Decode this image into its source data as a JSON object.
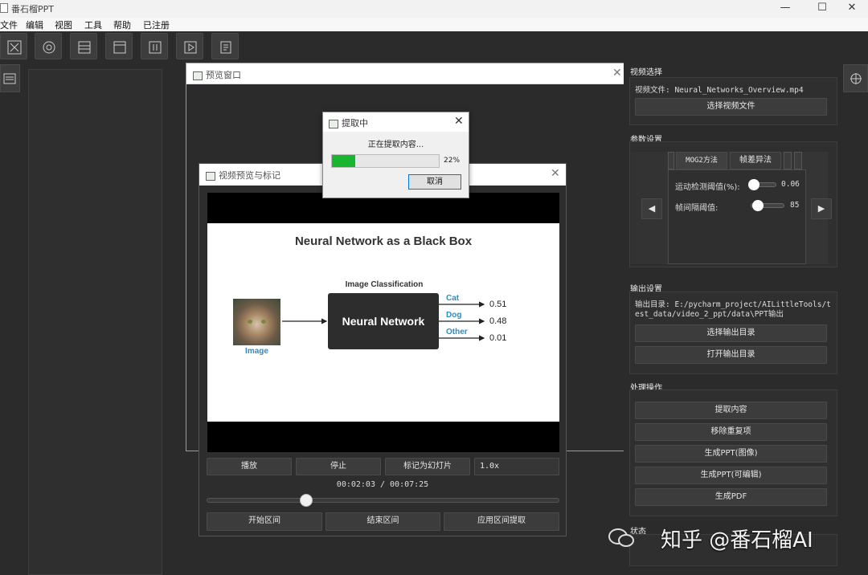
{
  "app": {
    "title": "番石榴PPT"
  },
  "menu": [
    "文件",
    "编辑",
    "视图",
    "工具",
    "帮助",
    "已注册"
  ],
  "toolbar": [
    "close-box-icon",
    "record-icon",
    "layout-icon",
    "window-icon",
    "columns-icon",
    "play-frame-icon",
    "document-icon"
  ],
  "preview_window": {
    "title": "预览窗口"
  },
  "progress_dialog": {
    "title": "提取中",
    "message": "正在提取内容...",
    "percent": "22%",
    "progress": 0.22,
    "cancel": "取消",
    "color": "#19b530"
  },
  "video_window": {
    "title": "视频预览与标记"
  },
  "slide": {
    "title": "Neural Network as a Black Box",
    "subtitle": "Image Classification",
    "box": "Neural Network",
    "image_label": "Image",
    "outputs": [
      {
        "label": "Cat",
        "value": "0.51"
      },
      {
        "label": "Dog",
        "value": "0.48"
      },
      {
        "label": "Other",
        "value": "0.01"
      }
    ],
    "accent": "#2b8cbe"
  },
  "player": {
    "play": "播放",
    "stop": "停止",
    "mark": "标记为幻灯片",
    "speed": "1.0x",
    "time": "00:02:03 / 00:07:25",
    "position": 0.28,
    "start": "开始区间",
    "end": "结束区间",
    "apply": "应用区间提取"
  },
  "right": {
    "video_group": "视频选择",
    "video_file": "视频文件: Neural_Networks_Overview.mp4",
    "choose_video": "选择视频文件",
    "param_group": "参数设置",
    "tab_mog": "MOG2方法",
    "tab_diff": "帧差异法",
    "motion_label": "运动检测阈值(%):",
    "motion_value": "0.06",
    "motion_level": 0.1,
    "frame_label": "帧间隔阈值:",
    "frame_value": "85",
    "frame_level": 0.2,
    "output_group": "输出设置",
    "output_dir": "输出目录: E:/pycharm_project/AILittleTools/test_data/video_2_ppt/data\\PPT输出",
    "choose_output": "选择输出目录",
    "open_output": "打开输出目录",
    "ops_group": "处理操作",
    "ops": [
      "提取内容",
      "移除重复项",
      "生成PPT(图像)",
      "生成PPT(可编辑)",
      "生成PDF"
    ],
    "status_group": "状态"
  },
  "watermark": "知乎 @番石榴AI"
}
